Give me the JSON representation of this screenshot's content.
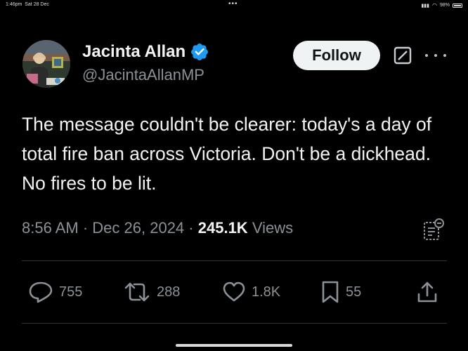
{
  "status_bar": {
    "time": "1:46pm",
    "date": "Sat 28 Dec",
    "center": "•••",
    "battery": "98%"
  },
  "author": {
    "name": "Jacinta Allan",
    "handle": "@JacintaAllanMP",
    "verified": true
  },
  "header": {
    "follow_label": "Follow"
  },
  "tweet": {
    "text": "The message couldn't be clearer: today's a day of total fire ban across Victoria. Don't be a dickhead. No fires to be lit.",
    "time": "8:56 AM",
    "date": "Dec 26, 2024",
    "views_count": "245.1K",
    "views_label": "Views"
  },
  "actions": {
    "replies": "755",
    "reposts": "288",
    "likes": "1.8K",
    "bookmarks": "55"
  },
  "colors": {
    "background": "#000000",
    "verified": "#1d9bf0",
    "muted": "#8b9197",
    "text": "#e7e9ea"
  }
}
